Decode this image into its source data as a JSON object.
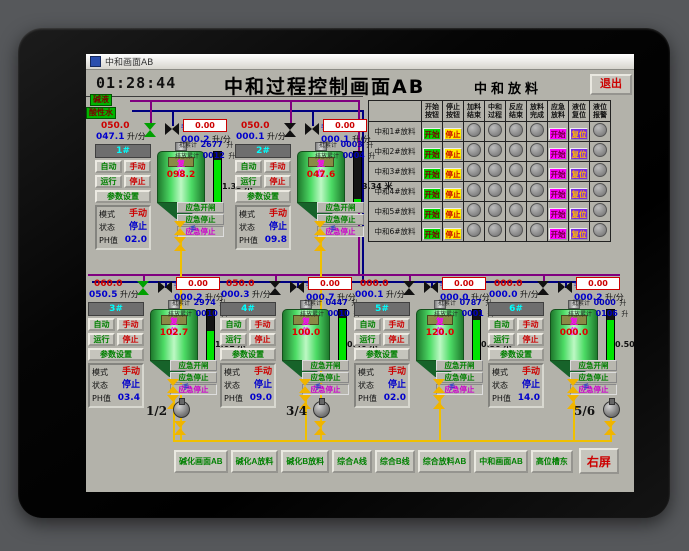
{
  "window": {
    "title": "中和画面AB"
  },
  "header": {
    "clock": "01:28:44",
    "title": "中和过程控制画面AB"
  },
  "sources": [
    {
      "label": "碱液"
    },
    {
      "label": "酸性水"
    }
  ],
  "labels": {
    "auto": "自动",
    "manual": "手动",
    "run": "运行",
    "stop": "停止",
    "params": "参数设置",
    "mode": "模式",
    "state": "状态",
    "ph": "PH值",
    "mode_value": "手动",
    "state_value": "停止",
    "tank_button": "复位",
    "batch": "批累计",
    "discharge": "排放累计",
    "liters": "升",
    "flow_unit": "升/分",
    "emergency": [
      "应急开闸",
      "应急停止",
      "应急停止"
    ],
    "valve_tag": "手"
  },
  "reactors": [
    {
      "id": "1#",
      "set": "050.0",
      "flow": "047.1",
      "meter": "0.00",
      "meter_flow": "000.2",
      "ph": "02.0",
      "tank_value": "098.2",
      "level": "1.33 米",
      "batch": "2677",
      "discharge": "0012",
      "level_pct": 85,
      "valve1": "green"
    },
    {
      "id": "2#",
      "set": "050.0",
      "flow": "000.1",
      "meter": "0.00",
      "meter_flow": "000.1",
      "ph": "09.8",
      "tank_value": "047.6",
      "level": "3.34 米",
      "batch": "0003",
      "discharge": "0004",
      "level_pct": 10,
      "valve1": "black"
    },
    {
      "id": "3#",
      "set": "060.0",
      "flow": "050.5",
      "meter": "0.00",
      "meter_flow": "000.2",
      "ph": "03.4",
      "tank_value": "102.7",
      "level": "1.61 米",
      "batch": "2974",
      "discharge": "0010",
      "level_pct": 60,
      "valve1": "green"
    },
    {
      "id": "4#",
      "set": "050.0",
      "flow": "000.3",
      "meter": "0.00",
      "meter_flow": "000.7",
      "ph": "09.0",
      "tank_value": "100.0",
      "level": "0.40 米",
      "batch": "0447",
      "discharge": "0010",
      "level_pct": 85,
      "valve1": "black"
    },
    {
      "id": "5#",
      "set": "000.0",
      "flow": "000.1",
      "meter": "0.00",
      "meter_flow": "000.0",
      "ph": "02.0",
      "tank_value": "120.0",
      "level": "0.50 米",
      "batch": "0787",
      "discharge": "0001",
      "level_pct": 80,
      "valve1": "black"
    },
    {
      "id": "6#",
      "set": "000.0",
      "flow": "000.0",
      "meter": "0.00",
      "meter_flow": "000.2",
      "ph": "14.0",
      "tank_value": "000.0",
      "level": "0.50 米",
      "batch": "0000",
      "discharge": "0106",
      "level_pct": 80,
      "valve1": "black"
    }
  ],
  "discharge_table": {
    "title": "中和放料",
    "exit": "退出",
    "columns": [
      "开始按钮",
      "停止按钮",
      "加料结束",
      "中和过程",
      "反应结束",
      "放料完成",
      "应急放料",
      "液位复位",
      "液位报警"
    ],
    "row_buttons": {
      "start": "开始",
      "stop": "停止",
      "em_start": "开始",
      "reset": "复位"
    },
    "rows": [
      {
        "label": "中和1#放料"
      },
      {
        "label": "中和2#放料"
      },
      {
        "label": "中和3#放料"
      },
      {
        "label": "中和4#放料"
      },
      {
        "label": "中和5#放料"
      },
      {
        "label": "中和6#放料"
      }
    ]
  },
  "pumps": [
    {
      "label": "1/2"
    },
    {
      "label": "3/4"
    },
    {
      "label": "5/6"
    }
  ],
  "nav": {
    "buttons": [
      "碱化画面AB",
      "碱化A放料",
      "碱化B放料",
      "综合A线",
      "综合B线",
      "综合放料AB",
      "中和画面AB",
      "高位槽东"
    ],
    "right_screen": "右屏"
  },
  "colors": {
    "pipe_purple": "#800080",
    "pipe_navy": "#000080",
    "pipe_yellow": "#f0c000",
    "tank_green": "#4ddc66",
    "level_green": "#00e400"
  }
}
